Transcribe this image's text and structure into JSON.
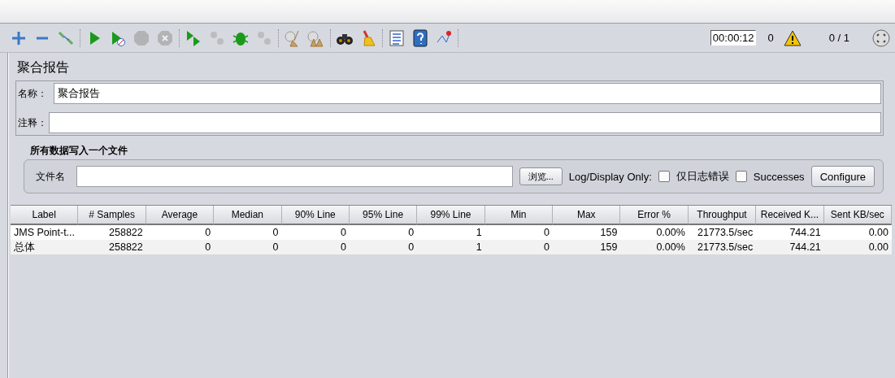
{
  "toolbar": {
    "groups": [
      [
        {
          "kind": "plus",
          "disabled": false
        },
        {
          "kind": "minus",
          "disabled": false
        },
        {
          "kind": "toggle",
          "disabled": false
        }
      ],
      [
        {
          "kind": "play",
          "disabled": false
        },
        {
          "kind": "play-timer",
          "disabled": false
        },
        {
          "kind": "stop",
          "disabled": true
        },
        {
          "kind": "shutdown",
          "disabled": true
        }
      ],
      [
        {
          "kind": "remote-play",
          "disabled": false
        },
        {
          "kind": "remote-dots",
          "disabled": true
        },
        {
          "kind": "bug",
          "disabled": false
        },
        {
          "kind": "remote-dots",
          "disabled": true
        }
      ],
      [
        {
          "kind": "broom",
          "disabled": false
        },
        {
          "kind": "brooms",
          "disabled": false
        }
      ],
      [
        {
          "kind": "binoculars",
          "disabled": false
        },
        {
          "kind": "brush",
          "disabled": false
        }
      ],
      [
        {
          "kind": "list",
          "disabled": false
        },
        {
          "kind": "help",
          "disabled": false
        },
        {
          "kind": "graph",
          "disabled": false
        }
      ]
    ],
    "timer": "00:00:12",
    "active_threads": "0",
    "thread_ratio": "0 / 1"
  },
  "panel": {
    "title": "聚合报告",
    "name_field": {
      "label": "名称：",
      "value": "聚合报告"
    },
    "comment_field": {
      "label": "注释："
    },
    "file_section": {
      "title": "所有数据写入一个文件",
      "file_label": "文件名",
      "browse_button": "浏览...",
      "log_label": "Log/Display Only:",
      "checkboxes": [
        {
          "label": "仅日志错误",
          "checked": false
        },
        {
          "label": "Successes",
          "checked": false
        }
      ],
      "configure_button": "Configure"
    }
  },
  "table": {
    "columns": [
      "Label",
      "# Samples",
      "Average",
      "Median",
      "90% Line",
      "95% Line",
      "99% Line",
      "Min",
      "Max",
      "Error %",
      "Throughput",
      "Received K...",
      "Sent KB/sec"
    ],
    "rows": [
      [
        "JMS Point-t...",
        "258822",
        "0",
        "0",
        "0",
        "0",
        "1",
        "0",
        "159",
        "0.00%",
        "21773.5/sec",
        "744.21",
        "0.00"
      ],
      [
        "总体",
        "258822",
        "0",
        "0",
        "0",
        "0",
        "1",
        "0",
        "159",
        "0.00%",
        "21773.5/sec",
        "744.21",
        "0.00"
      ]
    ]
  }
}
